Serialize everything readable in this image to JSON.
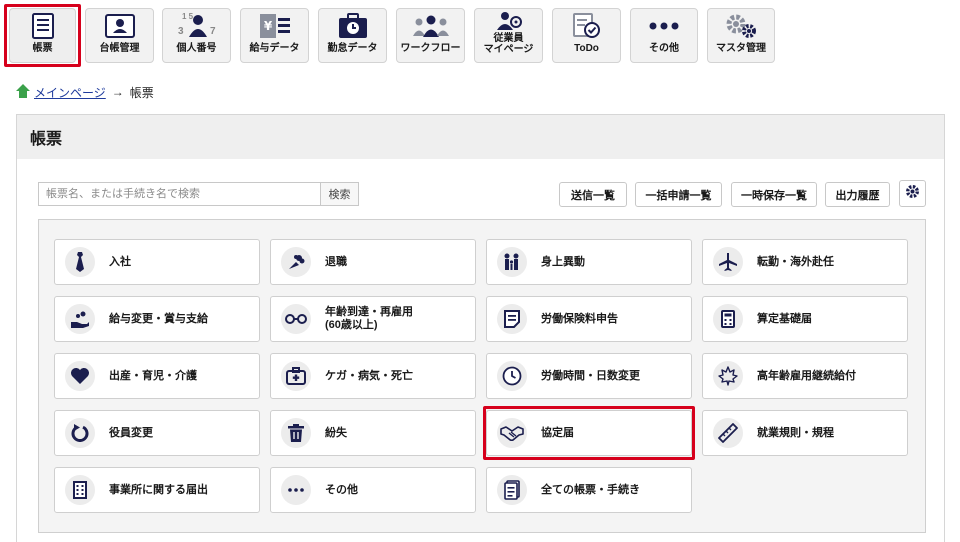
{
  "nav": {
    "items": [
      {
        "label": "帳票",
        "icon": "document-list-icon"
      },
      {
        "label": "台帳管理",
        "icon": "id-card-icon"
      },
      {
        "label": "個人番号",
        "icon": "person-number-icon"
      },
      {
        "label": "給与データ",
        "icon": "salary-data-icon"
      },
      {
        "label": "勤怠データ",
        "icon": "attendance-clock-icon"
      },
      {
        "label": "ワークフロー",
        "icon": "team-icon"
      },
      {
        "label": "従業員\nマイページ",
        "icon": "employee-page-icon"
      },
      {
        "label": "ToDo",
        "icon": "todo-check-icon"
      },
      {
        "label": "その他",
        "icon": "more-dots-icon"
      },
      {
        "label": "マスタ管理",
        "icon": "gears-icon"
      }
    ],
    "icon_glyphs": {
      "number_top": "1 5",
      "number_left": "3",
      "number_right": "7",
      "yen": "¥"
    }
  },
  "breadcrumb": {
    "home_link": "メインページ",
    "separator": "→",
    "current": "帳票"
  },
  "page": {
    "title": "帳票"
  },
  "search": {
    "placeholder": "帳票名、または手続き名で検索",
    "button": "検索"
  },
  "toolbar": {
    "sent_list": "送信一覧",
    "bulk_list": "一括申請一覧",
    "saved_list": "一時保存一覧",
    "output_history": "出力履歴"
  },
  "forms": [
    {
      "label": "入社",
      "icon": "necktie-icon"
    },
    {
      "label": "退職",
      "icon": "bouquet-icon"
    },
    {
      "label": "身上異動",
      "icon": "family-icon"
    },
    {
      "label": "転勤・海外赴任",
      "icon": "airplane-icon"
    },
    {
      "label": "給与変更・賞与支給",
      "icon": "money-hand-icon"
    },
    {
      "label": "年齢到達・再雇用\n(60歳以上)",
      "icon": "glasses-icon"
    },
    {
      "label": "労働保険料申告",
      "icon": "document-icon"
    },
    {
      "label": "算定基礎届",
      "icon": "calculator-icon"
    },
    {
      "label": "出産・育児・介護",
      "icon": "heart-icon"
    },
    {
      "label": "ケガ・病気・死亡",
      "icon": "first-aid-icon"
    },
    {
      "label": "労働時間・日数変更",
      "icon": "clock-icon"
    },
    {
      "label": "高年齢雇用継続給付",
      "icon": "maple-leaf-icon"
    },
    {
      "label": "役員変更",
      "icon": "rotate-icon"
    },
    {
      "label": "紛失",
      "icon": "trash-icon"
    },
    {
      "label": "協定届",
      "icon": "handshake-icon"
    },
    {
      "label": "就業規則・規程",
      "icon": "ruler-icon"
    },
    {
      "label": "事業所に関する届出",
      "icon": "building-icon"
    },
    {
      "label": "その他",
      "icon": "more-dots-icon"
    },
    {
      "label": "全ての帳票・手続き",
      "icon": "clipboard-icon"
    }
  ],
  "colors": {
    "accent_outline": "#d6001c",
    "icon_navy": "#1b1e4e",
    "home_green": "#3aa14a",
    "link_blue": "#1f3b9c"
  }
}
